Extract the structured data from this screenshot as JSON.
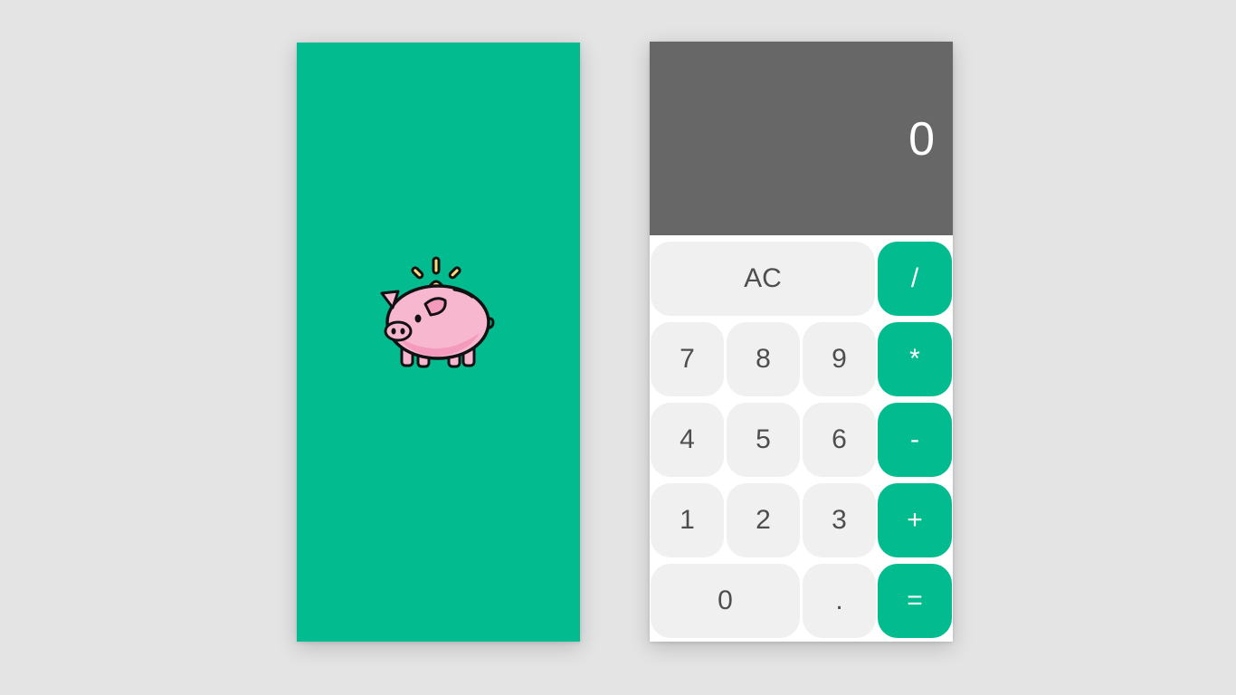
{
  "colors": {
    "background": "#e4e4e4",
    "brand_green": "#02bc8f",
    "display_gray": "#676767",
    "key_light": "#f0f0f0",
    "key_text": "#4e4e4e",
    "pig_pink": "#f7b8cf",
    "coin_yellow": "#f8dd78"
  },
  "splash": {
    "logo_icon": "piggy-bank-icon"
  },
  "calculator": {
    "display_value": "0",
    "keys": {
      "clear": "AC",
      "divide": "/",
      "multiply": "*",
      "subtract": "-",
      "add": "+",
      "equals": "=",
      "seven": "7",
      "eight": "8",
      "nine": "9",
      "four": "4",
      "five": "5",
      "six": "6",
      "one": "1",
      "two": "2",
      "three": "3",
      "zero": "0",
      "decimal": "."
    }
  }
}
